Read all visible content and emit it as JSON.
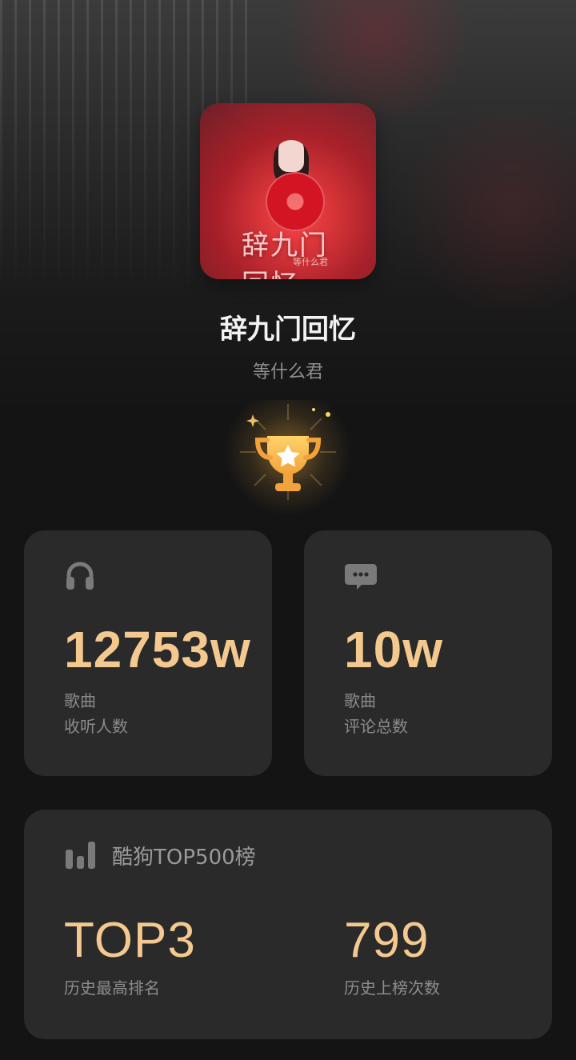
{
  "song": {
    "cover_title": "辞九门回忆",
    "cover_artist": "等什么君",
    "title": "辞九门回忆",
    "artist": "等什么君"
  },
  "icons": {
    "trophy": "trophy-icon",
    "listen": "headphones-icon",
    "comment": "chat-bubble-icon",
    "chart": "bar-chart-icon"
  },
  "stats": {
    "listeners": {
      "value": "12753w",
      "label_line1": "歌曲",
      "label_line2": "收听人数"
    },
    "comments": {
      "value": "10w",
      "label_line1": "歌曲",
      "label_line2": "评论总数"
    }
  },
  "chart": {
    "title": "酷狗TOP500榜",
    "best_rank": {
      "value": "TOP3",
      "label": "历史最高排名"
    },
    "times_on_chart": {
      "value": "799",
      "label": "历史上榜次数"
    }
  },
  "colors": {
    "accent": "#f4c98f",
    "card_bg": "#2a2a2a",
    "page_bg": "#141414",
    "muted_text": "#8c8c8c"
  }
}
